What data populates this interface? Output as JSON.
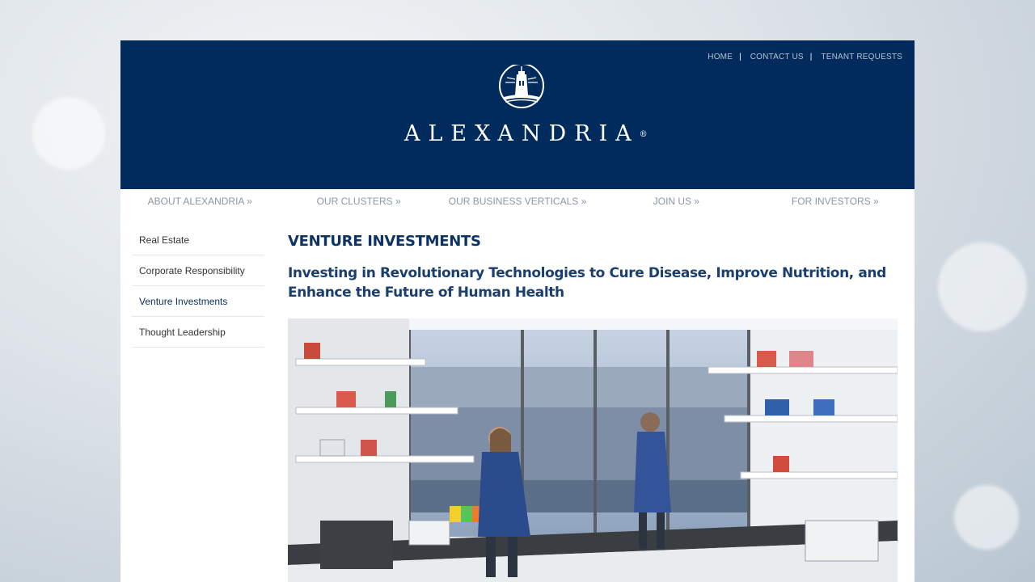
{
  "utility_nav": [
    "HOME",
    "CONTACT US",
    "TENANT REQUESTS"
  ],
  "brand": {
    "wordmark": "ALEXANDRIA",
    "registered": "®"
  },
  "main_nav": [
    "ABOUT ALEXANDRIA »",
    "OUR CLUSTERS »",
    "OUR BUSINESS VERTICALS »",
    "JOIN US »",
    "FOR INVESTORS »"
  ],
  "sidebar": {
    "items": [
      {
        "label": "Real Estate",
        "active": false
      },
      {
        "label": "Corporate Responsibility",
        "active": false
      },
      {
        "label": "Venture Investments",
        "active": true
      },
      {
        "label": "Thought Leadership",
        "active": false
      }
    ]
  },
  "content": {
    "title": "VENTURE INVESTMENTS",
    "subtitle": "Investing in Revolutionary Technologies to Cure Disease, Improve Nutrition, and Enhance the Future of Human Health"
  },
  "colors": {
    "header_bg": "#002b5c",
    "title": "#0d3263",
    "nav_text": "#8a97a6"
  }
}
